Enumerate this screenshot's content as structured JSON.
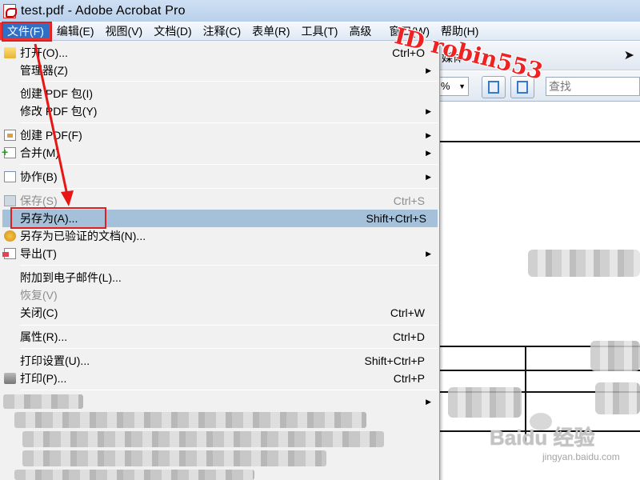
{
  "window": {
    "title": "test.pdf - Adobe Acrobat Pro"
  },
  "menubar": {
    "items": [
      "文件(F)",
      "编辑(E)",
      "视图(V)",
      "文档(D)",
      "注释(C)",
      "表单(R)",
      "工具(T)",
      "高级",
      "窗口(W)",
      "帮助(H)"
    ],
    "active_index": 0
  },
  "toolbar": {
    "partial_text": "媒体",
    "zoom_value": "%",
    "find_placeholder": "查找"
  },
  "file_menu": {
    "items": [
      {
        "label": "打开(O)...",
        "shortcut": "Ctrl+O",
        "icon": "folder-icon",
        "submenu": false,
        "disabled": false
      },
      {
        "label": "管理器(Z)",
        "shortcut": "",
        "icon": "",
        "submenu": true,
        "disabled": false
      },
      {
        "label": "创建 PDF 包(I)",
        "shortcut": "",
        "icon": "",
        "submenu": false,
        "disabled": false
      },
      {
        "label": "修改 PDF 包(Y)",
        "shortcut": "",
        "icon": "",
        "submenu": true,
        "disabled": false
      },
      {
        "label": "创建 PDF(F)",
        "shortcut": "",
        "icon": "create-pdf-icon",
        "submenu": true,
        "disabled": false
      },
      {
        "label": "合并(M)",
        "shortcut": "",
        "icon": "merge-icon",
        "submenu": true,
        "disabled": false
      },
      {
        "label": "协作(B)",
        "shortcut": "",
        "icon": "collaborate-icon",
        "submenu": true,
        "disabled": false
      },
      {
        "label": "保存(S)",
        "shortcut": "Ctrl+S",
        "icon": "save-icon",
        "submenu": false,
        "disabled": true
      },
      {
        "label": "另存为(A)...",
        "shortcut": "Shift+Ctrl+S",
        "icon": "",
        "submenu": false,
        "disabled": false,
        "highlighted": true
      },
      {
        "label": "另存为已验证的文档(N)...",
        "shortcut": "",
        "icon": "certified-icon",
        "submenu": false,
        "disabled": false
      },
      {
        "label": "导出(T)",
        "shortcut": "",
        "icon": "export-icon",
        "submenu": true,
        "disabled": false
      },
      {
        "label": "附加到电子邮件(L)...",
        "shortcut": "",
        "icon": "",
        "submenu": false,
        "disabled": false
      },
      {
        "label": "恢复(V)",
        "shortcut": "",
        "icon": "",
        "submenu": false,
        "disabled": true
      },
      {
        "label": "关闭(C)",
        "shortcut": "Ctrl+W",
        "icon": "",
        "submenu": false,
        "disabled": false
      },
      {
        "label": "属性(R)...",
        "shortcut": "Ctrl+D",
        "icon": "",
        "submenu": false,
        "disabled": false
      },
      {
        "label": "打印设置(U)...",
        "shortcut": "Shift+Ctrl+P",
        "icon": "",
        "submenu": false,
        "disabled": false
      },
      {
        "label": "打印(P)...",
        "shortcut": "Ctrl+P",
        "icon": "print-icon",
        "submenu": false,
        "disabled": false
      }
    ]
  },
  "annotations": {
    "watermark": "ID robin553",
    "baidu_logo": "Baidu 经验",
    "baidu_url": "jingyan.baidu.com"
  },
  "colors": {
    "menu_active_bg": "#2f6fc5",
    "menu_highlight_bg": "#a4c1d9",
    "annotation_red": "#e02020"
  }
}
